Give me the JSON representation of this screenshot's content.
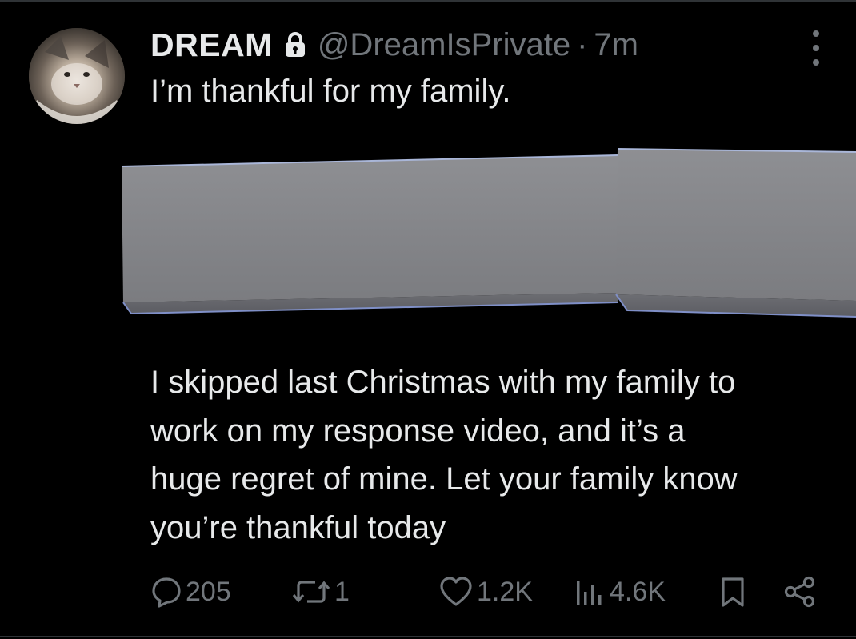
{
  "tweet": {
    "display_name": "DREAM",
    "handle": "@DreamIsPrivate",
    "separator": "·",
    "time": "7m",
    "text": "I’m thankful for my family.",
    "body_lines": [
      "I skipped last Christmas with my family to",
      "work on my response video, and it’s a",
      "huge regret of mine. Let your family know",
      "you’re thankful today"
    ]
  },
  "actions": {
    "replies": "205",
    "reposts": "1",
    "likes": "1.2K",
    "views": "4.6K"
  },
  "icons": {
    "lock": "lock-icon",
    "more": "more-icon",
    "reply": "reply-icon",
    "repost": "repost-icon",
    "like": "heart-icon",
    "views": "views-icon",
    "bookmark": "bookmark-icon",
    "share": "share-icon"
  },
  "colors": {
    "background": "#000000",
    "text_primary": "#e7e9ea",
    "text_secondary": "#71767b",
    "divider": "#2f3336"
  }
}
